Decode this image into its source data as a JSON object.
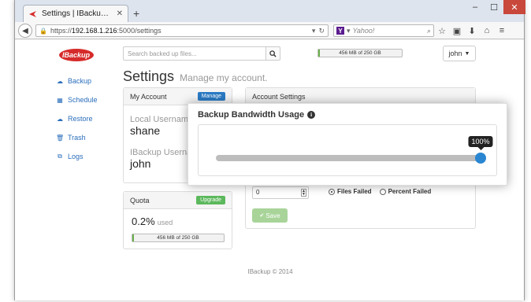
{
  "browser": {
    "tab_title": "Settings | IBackup - DataCe...",
    "new_tab_symbol": "+",
    "url_prefix": "https://",
    "url_host": "192.168.1.216",
    "url_rest": ":5000/settings",
    "search_placeholder": "Yahoo!",
    "window_controls": [
      "minimize-icon",
      "maximize-icon",
      "close-icon"
    ],
    "toolbar_icons": [
      "star-icon",
      "clipboard-icon",
      "download-icon",
      "home-icon",
      "menu-icon"
    ]
  },
  "header": {
    "logo_text": "IBackup",
    "search_placeholder": "Search backed up files...",
    "quota_text": "456 MB of 250 GB",
    "quota_fraction": 0.02,
    "user_label": "john"
  },
  "sidebar": {
    "items": [
      {
        "label": "Backup",
        "icon": "cloud-upload-icon"
      },
      {
        "label": "Schedule",
        "icon": "calendar-icon"
      },
      {
        "label": "Restore",
        "icon": "cloud-download-icon"
      },
      {
        "label": "Trash",
        "icon": "trash-icon"
      },
      {
        "label": "Logs",
        "icon": "copy-icon"
      }
    ]
  },
  "page": {
    "title": "Settings",
    "subtitle": "Manage my account."
  },
  "account_panel": {
    "title": "My Account",
    "manage_label": "Manage",
    "local_username_label": "Local Username",
    "local_username_value": "shane",
    "ibackup_username_label": "IBackup Username",
    "ibackup_username_value": "john"
  },
  "settings_panel": {
    "title": "Account Settings",
    "stepper_value": "0",
    "radio_files_failed": "Files Failed",
    "radio_percent_failed": "Percent Failed",
    "selected_radio": "files_failed",
    "save_label": "Save"
  },
  "quota_panel": {
    "title": "Quota",
    "upgrade_label": "Upgrade",
    "used_value": "0.2%",
    "used_suffix": "used",
    "bar_text": "456 MB of 250 GB",
    "bar_fraction": 0.02
  },
  "overlay": {
    "title": "Backup Bandwidth Usage",
    "slider_value_percent": 100,
    "tooltip_label": "100%"
  },
  "footer": {
    "text": "IBackup © 2014"
  },
  "colors": {
    "link_blue": "#2a6ebb",
    "primary_blue": "#2a7bc4",
    "success_green": "#5cb85c",
    "slider_blue": "#2a86d1"
  }
}
